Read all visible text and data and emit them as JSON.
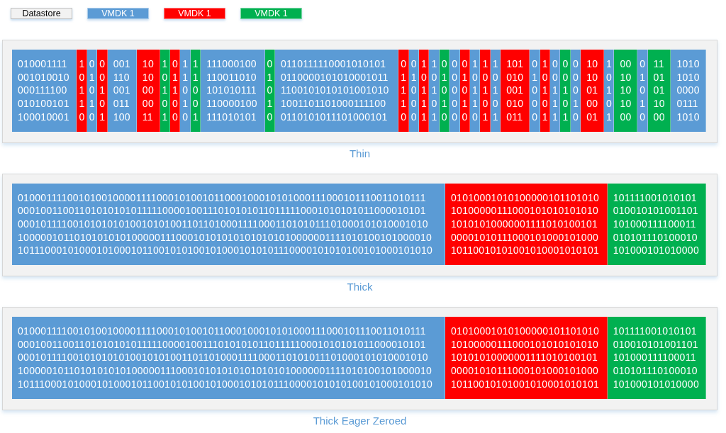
{
  "legend": [
    {
      "label": "Datastore",
      "kind": "datastore",
      "color": "#f2f2f2"
    },
    {
      "label": "VMDK 1",
      "kind": "disk",
      "color": "#5b9bd5"
    },
    {
      "label": "VMDK 1",
      "kind": "disk",
      "color": "#ff0000"
    },
    {
      "label": "VMDK 1",
      "kind": "disk",
      "color": "#00b050"
    }
  ],
  "panels": [
    {
      "caption": "Thin",
      "segments": [
        {
          "color": "#5b9bd5",
          "lines": [
            "010001111",
            "001010010",
            "000111100",
            "010100101",
            "100010001"
          ]
        },
        {
          "color": "#ff0000",
          "lines": [
            "1",
            "0",
            "1",
            "1",
            "0"
          ]
        },
        {
          "color": "#5b9bd5",
          "lines": [
            "0",
            "1",
            "0",
            "1",
            "0"
          ]
        },
        {
          "color": "#ff0000",
          "lines": [
            "0",
            "0",
            "1",
            "0",
            "1"
          ]
        },
        {
          "color": "#5b9bd5",
          "lines": [
            "001",
            "110",
            "001",
            "011",
            "100"
          ]
        },
        {
          "color": "#ff0000",
          "lines": [
            "10",
            "10",
            "00",
            "00",
            "11"
          ]
        },
        {
          "color": "#00b050",
          "lines": [
            "1",
            "0",
            "1",
            "0",
            "1"
          ]
        },
        {
          "color": "#ff0000",
          "lines": [
            "0",
            "1",
            "1",
            "0",
            "0"
          ]
        },
        {
          "color": "#5b9bd5",
          "lines": [
            "1",
            "1",
            "0",
            "1",
            "0"
          ]
        },
        {
          "color": "#00b050",
          "lines": [
            "1",
            "1",
            "0",
            "0",
            "1"
          ]
        },
        {
          "color": "#5b9bd5",
          "lines": [
            "111000100",
            "110011010",
            "101010111",
            "110000100",
            "111010101"
          ]
        },
        {
          "color": "#00b050",
          "lines": [
            "0",
            "1",
            "0",
            "1",
            "0"
          ]
        },
        {
          "color": "#5b9bd5",
          "lines": [
            "0110111110001010101",
            "0110000101010001011",
            "1100101010101001010",
            "1001101101000111100",
            "0110101011101000101"
          ]
        },
        {
          "color": "#ff0000",
          "lines": [
            "0",
            "1",
            "1",
            "1",
            "0"
          ]
        },
        {
          "color": "#5b9bd5",
          "lines": [
            "0",
            "1",
            "0",
            "0",
            "0"
          ]
        },
        {
          "color": "#ff0000",
          "lines": [
            "1",
            "0",
            "1",
            "1",
            "1"
          ]
        },
        {
          "color": "#5b9bd5",
          "lines": [
            "1",
            "0",
            "1",
            "0",
            "1"
          ]
        },
        {
          "color": "#00b050",
          "lines": [
            "0",
            "1",
            "0",
            "1",
            "0"
          ]
        },
        {
          "color": "#5b9bd5",
          "lines": [
            "0",
            "0",
            "0",
            "0",
            "0"
          ]
        },
        {
          "color": "#ff0000",
          "lines": [
            "0",
            "1",
            "0",
            "1",
            "0"
          ]
        },
        {
          "color": "#5b9bd5",
          "lines": [
            "1",
            "0",
            "1",
            "1",
            "0"
          ]
        },
        {
          "color": "#ff0000",
          "lines": [
            "1",
            "0",
            "1",
            "0",
            "1"
          ]
        },
        {
          "color": "#5b9bd5",
          "lines": [
            "1",
            "0",
            "1",
            "0",
            "1"
          ]
        },
        {
          "color": "#ff0000",
          "lines": [
            "101",
            "010",
            "001",
            "010",
            "011"
          ]
        },
        {
          "color": "#5b9bd5",
          "lines": [
            "0",
            "1",
            "0",
            "0",
            "0"
          ]
        },
        {
          "color": "#ff0000",
          "lines": [
            "1",
            "0",
            "1",
            "0",
            "1"
          ]
        },
        {
          "color": "#5b9bd5",
          "lines": [
            "0",
            "0",
            "1",
            "1",
            "1"
          ]
        },
        {
          "color": "#00b050",
          "lines": [
            "0",
            "0",
            "1",
            "0",
            "1"
          ]
        },
        {
          "color": "#5b9bd5",
          "lines": [
            "0",
            "0",
            "0",
            "1",
            "0"
          ]
        },
        {
          "color": "#ff0000",
          "lines": [
            "10",
            "10",
            "01",
            "00",
            "01"
          ]
        },
        {
          "color": "#5b9bd5",
          "lines": [
            "1",
            "0",
            "1",
            "0",
            "1"
          ]
        },
        {
          "color": "#00b050",
          "lines": [
            "00",
            "10",
            "10",
            "10",
            "00"
          ]
        },
        {
          "color": "#5b9bd5",
          "lines": [
            "0",
            "1",
            "0",
            "1",
            "0"
          ]
        },
        {
          "color": "#00b050",
          "lines": [
            "11",
            "01",
            "01",
            "10",
            "00"
          ]
        },
        {
          "color": "#5b9bd5",
          "lines": [
            "1010",
            "1010",
            "0000",
            "0111",
            "1010"
          ]
        }
      ]
    },
    {
      "caption": "Thick",
      "segments": [
        {
          "color": "#5b9bd5",
          "lines": [
            "0100011110010100100001111000101001011000100010101000111000101110011010111",
            "0001001100110101010101111100001001110101010110111110001010101011000010101",
            "0001011110010101010100101010011011010001111000110101011101000101010001010",
            "1000001011010101010100000111000101010101010101010000001111010100101000010",
            "1011100010100010100010110010101001010001010101110000101010100101000101010"
          ]
        },
        {
          "color": "#ff0000",
          "lines": [
            "01010001010100000101101010",
            "10100000111000101010101010",
            "10101010000001111010100101",
            "00001010111000101000101000",
            "10110010101001010001010101"
          ]
        },
        {
          "color": "#00b050",
          "lines": [
            "101111001010101",
            "010010101001101",
            "101000111100011",
            "010101110100010",
            "101000101010000"
          ]
        }
      ]
    },
    {
      "caption": "Thick Eager Zeroed",
      "segments": [
        {
          "color": "#5b9bd5",
          "lines": [
            "0100011110010100100001111000101001011000100010101000111000101110011010111",
            "0001001100110101010101111100001001110101010110111110001010101011000010101",
            "0001011110010101010100101010011011010001111000110101011101000101010001010",
            "1000001011010101010100000111000101010101010101010000001111010100101000010",
            "1011100010100010100010110010101001010001010101110000101010100101000101010"
          ]
        },
        {
          "color": "#ff0000",
          "lines": [
            "01010001010100000101101010",
            "10100000111000101010101010",
            "10101010000001111010100101",
            "00001010111000101000101000",
            "10110010101001010001010101"
          ]
        },
        {
          "color": "#00b050",
          "lines": [
            "101111001010101",
            "010010101001101",
            "101000111100011",
            "010101110100010",
            "101000101010000"
          ]
        }
      ]
    }
  ]
}
